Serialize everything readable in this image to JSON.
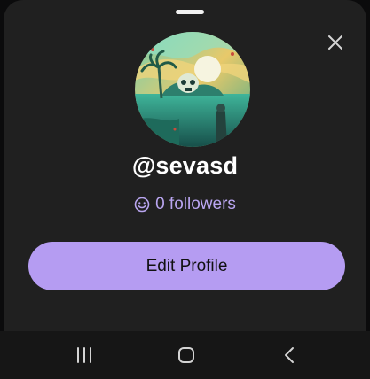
{
  "profile": {
    "username": "@sevasd",
    "followers_text": "0 followers",
    "avatar_description": "illustrated skull island artwork"
  },
  "actions": {
    "edit_profile_label": "Edit Profile"
  },
  "icons": {
    "close": "close-icon",
    "followers": "smiley-icon",
    "nav_recents": "recents-icon",
    "nav_home": "home-icon",
    "nav_back": "back-icon"
  },
  "colors": {
    "sheet_background": "#202020",
    "accent": "#b59cf2",
    "followers_text": "#b9a5f0",
    "navbar": "#161616"
  }
}
